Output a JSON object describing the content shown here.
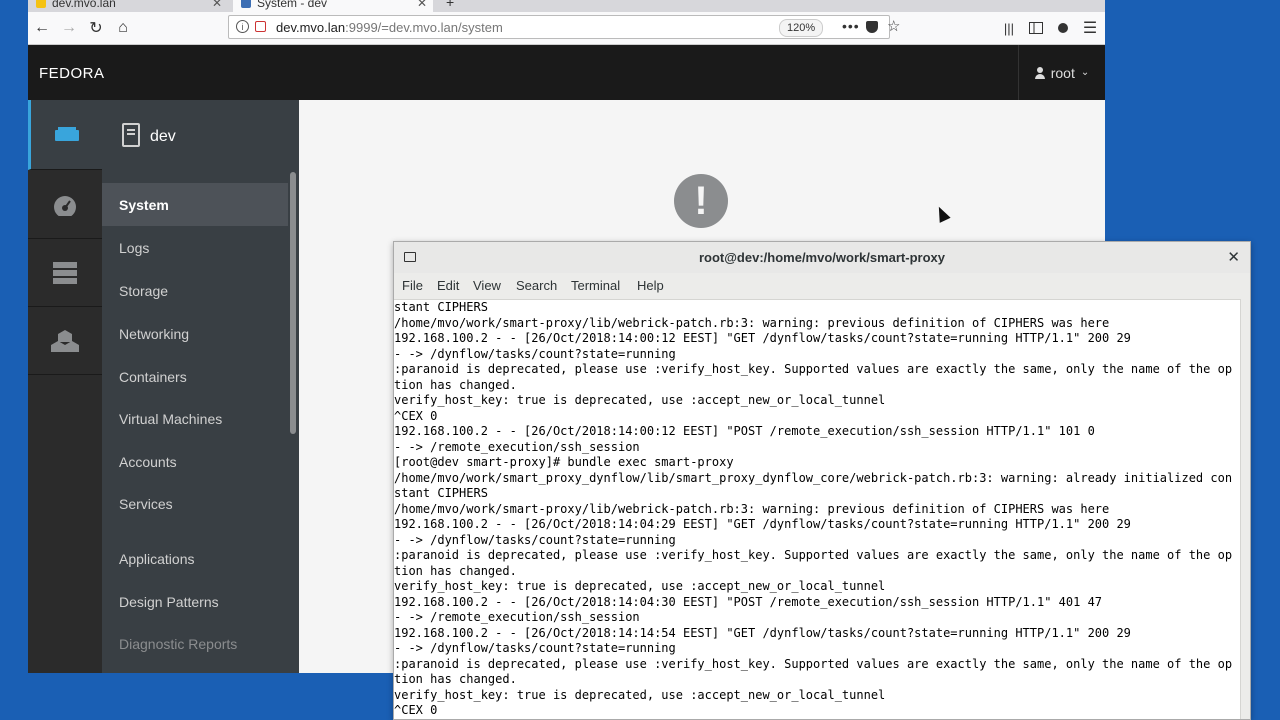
{
  "browser": {
    "tabs": [
      {
        "label": "dev.mvo.lan",
        "favicon_color": "#f5c211"
      },
      {
        "label": "System - dev",
        "favicon_color": "#3c6eb4"
      }
    ],
    "new_tab_label": "+",
    "url_host": "dev.mvo.lan",
    "url_rest": ":9999/=dev.mvo.lan/system",
    "zoom": "120%",
    "more_label": "•••",
    "star_label": "☆"
  },
  "cockpit": {
    "brand": "FEDORA",
    "user": "root",
    "host": "dev",
    "alert_symbol": "!",
    "menu": [
      {
        "label": "System",
        "active": true
      },
      {
        "label": "Logs"
      },
      {
        "label": "Storage"
      },
      {
        "label": "Networking"
      },
      {
        "label": "Containers"
      },
      {
        "label": "Virtual Machines"
      },
      {
        "label": "Accounts"
      },
      {
        "label": "Services"
      },
      {
        "label": "Applications"
      },
      {
        "label": "Design Patterns"
      },
      {
        "label": "Diagnostic Reports",
        "dim": true
      }
    ]
  },
  "terminal": {
    "title": "root@dev:/home/mvo/work/smart-proxy",
    "menu": [
      "File",
      "Edit",
      "View",
      "Search",
      "Terminal",
      "Help"
    ],
    "lines": [
      "stant CIPHERS",
      "/home/mvo/work/smart-proxy/lib/webrick-patch.rb:3: warning: previous definition of CIPHERS was here",
      "192.168.100.2 - - [26/Oct/2018:14:00:12 EEST] \"GET /dynflow/tasks/count?state=running HTTP/1.1\" 200 29",
      "- -> /dynflow/tasks/count?state=running",
      ":paranoid is deprecated, please use :verify_host_key. Supported values are exactly the same, only the name of the op",
      "tion has changed.",
      "verify_host_key: true is deprecated, use :accept_new_or_local_tunnel",
      "^CEX 0",
      "192.168.100.2 - - [26/Oct/2018:14:00:12 EEST] \"POST /remote_execution/ssh_session HTTP/1.1\" 101 0",
      "- -> /remote_execution/ssh_session",
      "[root@dev smart-proxy]# bundle exec smart-proxy",
      "/home/mvo/work/smart_proxy_dynflow/lib/smart_proxy_dynflow_core/webrick-patch.rb:3: warning: already initialized con",
      "stant CIPHERS",
      "/home/mvo/work/smart-proxy/lib/webrick-patch.rb:3: warning: previous definition of CIPHERS was here",
      "192.168.100.2 - - [26/Oct/2018:14:04:29 EEST] \"GET /dynflow/tasks/count?state=running HTTP/1.1\" 200 29",
      "- -> /dynflow/tasks/count?state=running",
      ":paranoid is deprecated, please use :verify_host_key. Supported values are exactly the same, only the name of the op",
      "tion has changed.",
      "verify_host_key: true is deprecated, use :accept_new_or_local_tunnel",
      "192.168.100.2 - - [26/Oct/2018:14:04:30 EEST] \"POST /remote_execution/ssh_session HTTP/1.1\" 401 47",
      "- -> /remote_execution/ssh_session",
      "192.168.100.2 - - [26/Oct/2018:14:14:54 EEST] \"GET /dynflow/tasks/count?state=running HTTP/1.1\" 200 29",
      "- -> /dynflow/tasks/count?state=running",
      ":paranoid is deprecated, please use :verify_host_key. Supported values are exactly the same, only the name of the op",
      "tion has changed.",
      "verify_host_key: true is deprecated, use :accept_new_or_local_tunnel",
      "^CEX 0"
    ]
  }
}
